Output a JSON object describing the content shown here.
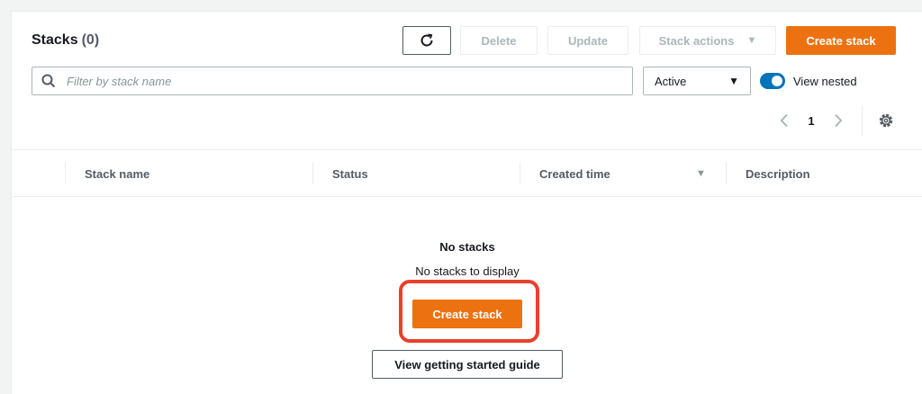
{
  "header": {
    "title": "Stacks",
    "count": "(0)",
    "buttons": {
      "delete": "Delete",
      "update": "Update",
      "stack_actions": "Stack actions",
      "create_stack": "Create stack"
    },
    "search": {
      "placeholder": "Filter by stack name",
      "value": ""
    },
    "filter_select": {
      "selected": "Active"
    },
    "toggle": {
      "label": "View nested",
      "on": true
    },
    "pagination": {
      "current_page": "1"
    }
  },
  "table": {
    "columns": [
      "Stack name",
      "Status",
      "Created time",
      "Description"
    ],
    "sorted_column": "Created time"
  },
  "empty_state": {
    "title": "No stacks",
    "subtitle": "No stacks to display",
    "primary_button": "Create stack",
    "secondary_button": "View getting started guide"
  },
  "colors": {
    "primary": "#ec7211",
    "toggle_on": "#0073bb",
    "highlight": "#e8412c"
  },
  "icons": {
    "refresh": "refresh-icon",
    "search": "search-icon",
    "prev": "chevron-left-icon",
    "next": "chevron-right-icon",
    "settings": "gear-icon",
    "dropdown": "caret-down-icon"
  }
}
